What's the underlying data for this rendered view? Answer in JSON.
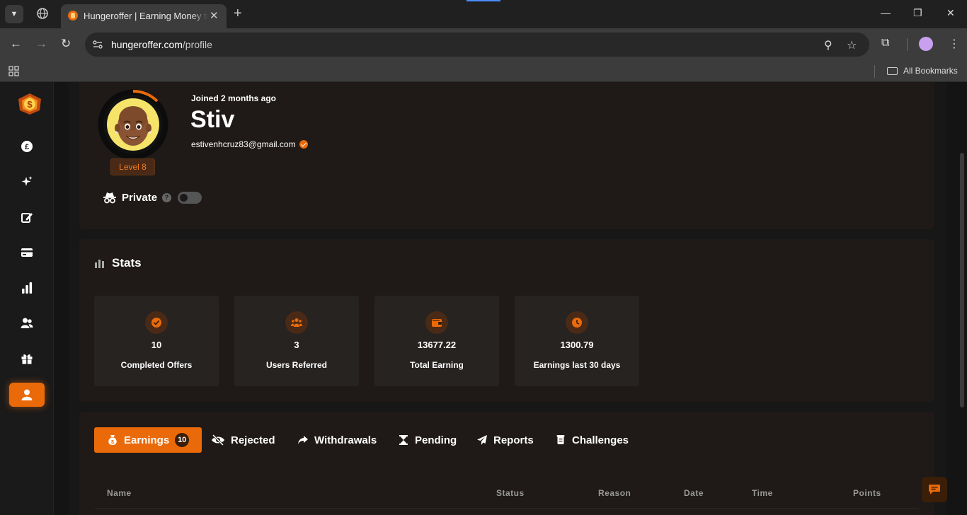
{
  "browser": {
    "tab_title": "Hungeroffer | Earning Money to",
    "url_host": "hungeroffer.com",
    "url_path": "/profile",
    "all_bookmarks": "All Bookmarks"
  },
  "profile": {
    "joined": "Joined 2 months ago",
    "username": "Stiv",
    "email": "estivenhcruz83@gmail.com",
    "level": "Level 8",
    "private_label": "Private",
    "help_mark": "?",
    "private_enabled": false
  },
  "stats": {
    "title": "Stats",
    "items": [
      {
        "value": "10",
        "label": "Completed Offers",
        "icon": "check-circle-icon"
      },
      {
        "value": "3",
        "label": "Users Referred",
        "icon": "users-icon"
      },
      {
        "value": "13677.22",
        "label": "Total Earning",
        "icon": "wallet-icon"
      },
      {
        "value": "1300.79",
        "label": "Earnings last 30 days",
        "icon": "clock-icon"
      }
    ]
  },
  "tabs": [
    {
      "label": "Earnings",
      "count": "10",
      "icon": "money-bag-icon",
      "active": true
    },
    {
      "label": "Rejected",
      "icon": "eye-slash-icon",
      "active": false
    },
    {
      "label": "Withdrawals",
      "icon": "share-icon",
      "active": false
    },
    {
      "label": "Pending",
      "icon": "hourglass-icon",
      "active": false
    },
    {
      "label": "Reports",
      "icon": "paper-plane-icon",
      "active": false
    },
    {
      "label": "Challenges",
      "icon": "scroll-icon",
      "active": false
    }
  ],
  "table": {
    "columns": [
      "Name",
      "Status",
      "Reason",
      "Date",
      "Time",
      "Points"
    ]
  },
  "colors": {
    "accent": "#ea6a0a",
    "card": "#1f1a17",
    "stat_box": "#262321"
  }
}
